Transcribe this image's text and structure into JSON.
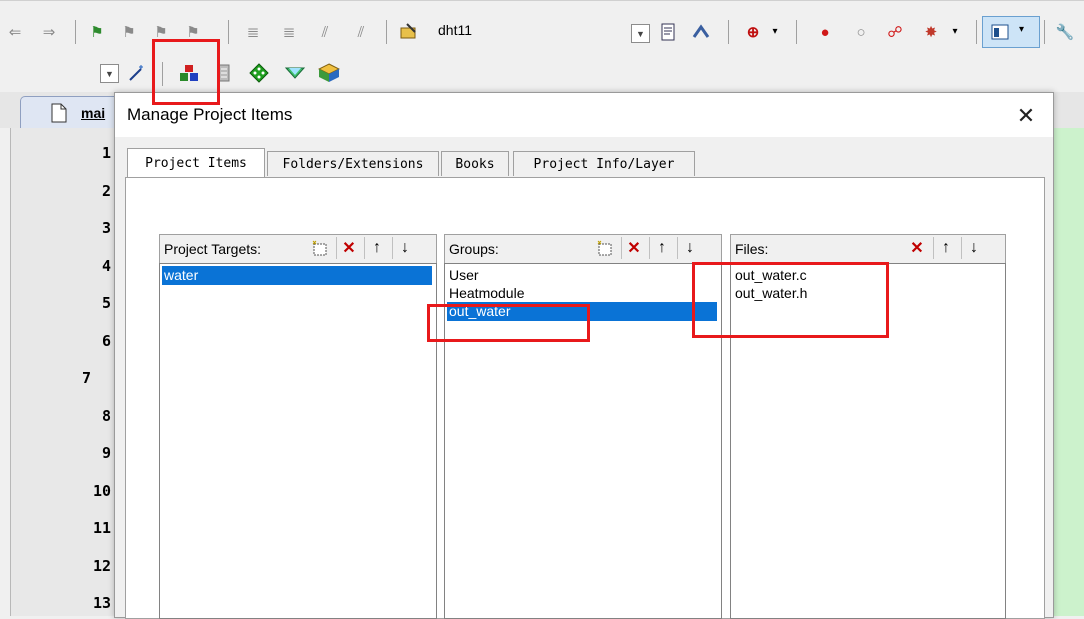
{
  "toolbar": {
    "target_name": "dht11"
  },
  "editor": {
    "tab_label": "mai",
    "line_numbers": [
      "1",
      "2",
      "3",
      "4",
      "5",
      "6",
      "7",
      "8",
      "9",
      "10",
      "11",
      "12",
      "13"
    ]
  },
  "dialog": {
    "title": "Manage Project Items",
    "tabs": [
      "Project Items",
      "Folders/Extensions",
      "Books",
      "Project Info/Layer"
    ],
    "targets": {
      "header": "Project Targets:",
      "items": [
        "water"
      ],
      "selected": "water"
    },
    "groups": {
      "header": "Groups:",
      "items": [
        "User",
        "Heatmodule",
        "out_water"
      ],
      "selected": "out_water"
    },
    "files": {
      "header": "Files:",
      "items": [
        "out_water.c",
        "out_water.h"
      ]
    }
  },
  "colors": {
    "selection": "#0a73d6",
    "highlight_box": "#e8191b",
    "green_margin": "#ccf2cc"
  }
}
